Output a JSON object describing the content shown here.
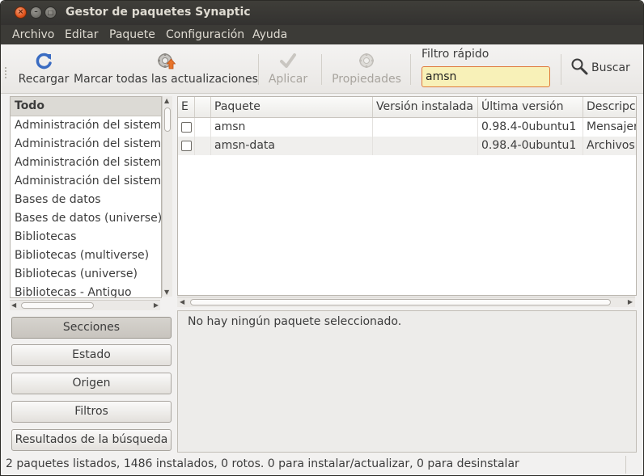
{
  "window": {
    "title": "Gestor de paquetes Synaptic",
    "close_glyph": "×",
    "min_glyph": "–",
    "max_glyph": "□"
  },
  "menubar": {
    "items": [
      "Archivo",
      "Editar",
      "Paquete",
      "Configuración",
      "Ayuda"
    ]
  },
  "toolbar": {
    "reload_label": "Recargar",
    "reload_icon": "reload-icon",
    "mark_all_label": "Marcar todas las actualizaciones",
    "mark_all_icon": "upgrade-icon",
    "apply_label": "Aplicar",
    "apply_icon": "checkmark-icon",
    "properties_label": "Propiedades",
    "properties_icon": "properties-icon",
    "quick_filter_label": "Filtro rápido",
    "quick_filter_value": "amsn",
    "search_label": "Buscar",
    "search_icon": "search-icon"
  },
  "sections": {
    "header": "Todo",
    "items": [
      "Administración del sistema",
      "Administración del sistema",
      "Administración del sistema",
      "Administración del sistema",
      "Bases de datos",
      "Bases de datos (universe)",
      "Bibliotecas",
      "Bibliotecas (multiverse)",
      "Bibliotecas (universe)",
      "Bibliotecas - Antiguo"
    ]
  },
  "filter_buttons": {
    "sections": "Secciones",
    "status": "Estado",
    "origin": "Origen",
    "filters": "Filtros",
    "search_results": "Resultados de la búsqueda"
  },
  "packages": {
    "columns": {
      "state": "E",
      "package": "Paquete",
      "installed_version": "Versión instalada",
      "latest_version": "Última versión",
      "description": "Descripción"
    },
    "rows": [
      {
        "name": "amsn",
        "installed": "",
        "latest": "0.98.4-0ubuntu1",
        "description": "Mensajero de MSN"
      },
      {
        "name": "amsn-data",
        "installed": "",
        "latest": "0.98.4-0ubuntu1",
        "description": "Archivos de datos para amsn"
      }
    ]
  },
  "details": {
    "empty_text": "No hay ningún paquete seleccionado."
  },
  "status": {
    "text": "2 paquetes listados, 1486 instalados, 0 rotos. 0 para instalar/actualizar, 0 para desinstalar"
  },
  "colors": {
    "titlebar": "#3c3b37",
    "accent": "#e07a3c",
    "filter_bg": "#f8f1b8"
  }
}
